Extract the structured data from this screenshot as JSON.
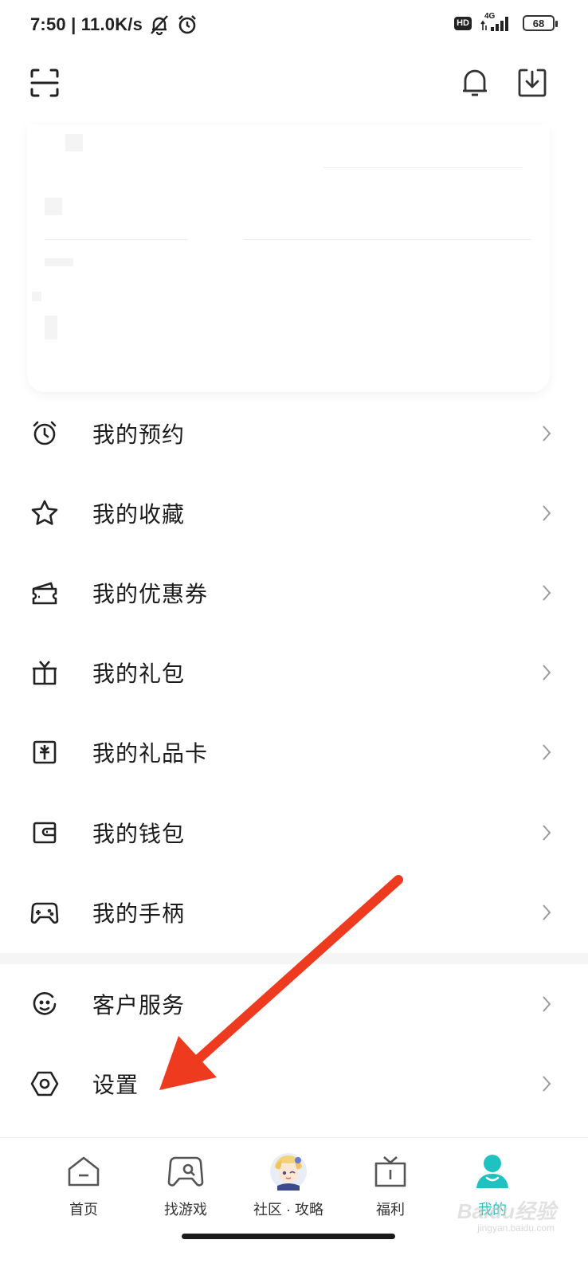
{
  "status_bar": {
    "time_speed": "7:50 | 11.0K/s",
    "hd": "HD",
    "network": "4G",
    "battery": "68"
  },
  "header": {
    "scan_icon": "scan-icon",
    "bell_icon": "bell-icon",
    "download_icon": "download-icon"
  },
  "menu": {
    "items": [
      {
        "label": "我的预约",
        "icon": "alarm-clock-icon"
      },
      {
        "label": "我的收藏",
        "icon": "star-icon"
      },
      {
        "label": "我的优惠券",
        "icon": "coupon-icon"
      },
      {
        "label": "我的礼包",
        "icon": "gift-icon"
      },
      {
        "label": "我的礼品卡",
        "icon": "gift-card-icon"
      },
      {
        "label": "我的钱包",
        "icon": "wallet-icon"
      },
      {
        "label": "我的手柄",
        "icon": "gamepad-icon"
      },
      {
        "label": "客户服务",
        "icon": "customer-service-icon"
      },
      {
        "label": "设置",
        "icon": "settings-icon"
      }
    ]
  },
  "bottom_nav": {
    "items": [
      {
        "label": "首页",
        "icon": "home-icon"
      },
      {
        "label": "找游戏",
        "icon": "find-game-icon"
      },
      {
        "label": "社区 · 攻略",
        "icon": "community-avatar-icon"
      },
      {
        "label": "福利",
        "icon": "welfare-icon"
      },
      {
        "label": "我的",
        "icon": "profile-icon",
        "active": true
      }
    ]
  },
  "colors": {
    "accent": "#1fc1c1",
    "arrow": "#ee3a1f"
  },
  "watermark": {
    "text": "Baidu经验",
    "sub": "jingyan.baidu.com"
  }
}
